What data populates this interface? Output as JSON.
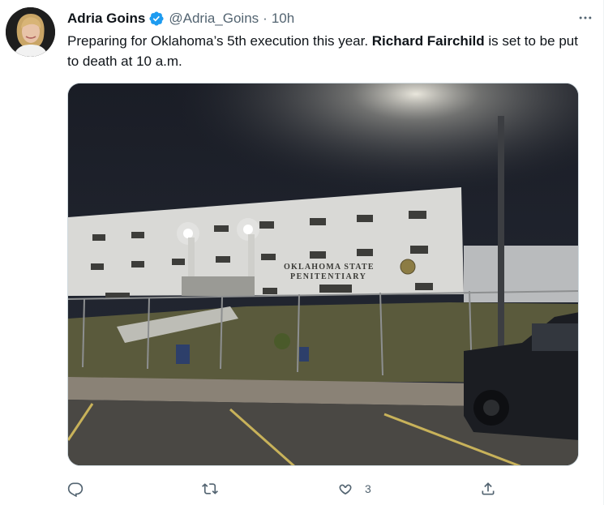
{
  "tweet": {
    "author_name": "Adria Goins",
    "handle": "@Adria_Goins",
    "separator": "·",
    "time": "10h",
    "text_before": "Preparing for Oklahoma’s 5th execution this year. ",
    "text_bold": "Richard Fairchild",
    "text_after": " is set to be put to death at 10 a.m."
  },
  "media": {
    "sign_line1": "OKLAHOMA STATE",
    "sign_line2": "PENITENTIARY"
  },
  "actions": {
    "reply_count": "",
    "retweet_count": "",
    "like_count": "3",
    "share_count": ""
  },
  "colors": {
    "secondary_text": "#536471",
    "verified_blue": "#1d9bf0",
    "border": "#cfd9de"
  },
  "icons": [
    "verified-badge-icon",
    "more-icon",
    "reply-icon",
    "retweet-icon",
    "like-icon",
    "share-icon"
  ]
}
